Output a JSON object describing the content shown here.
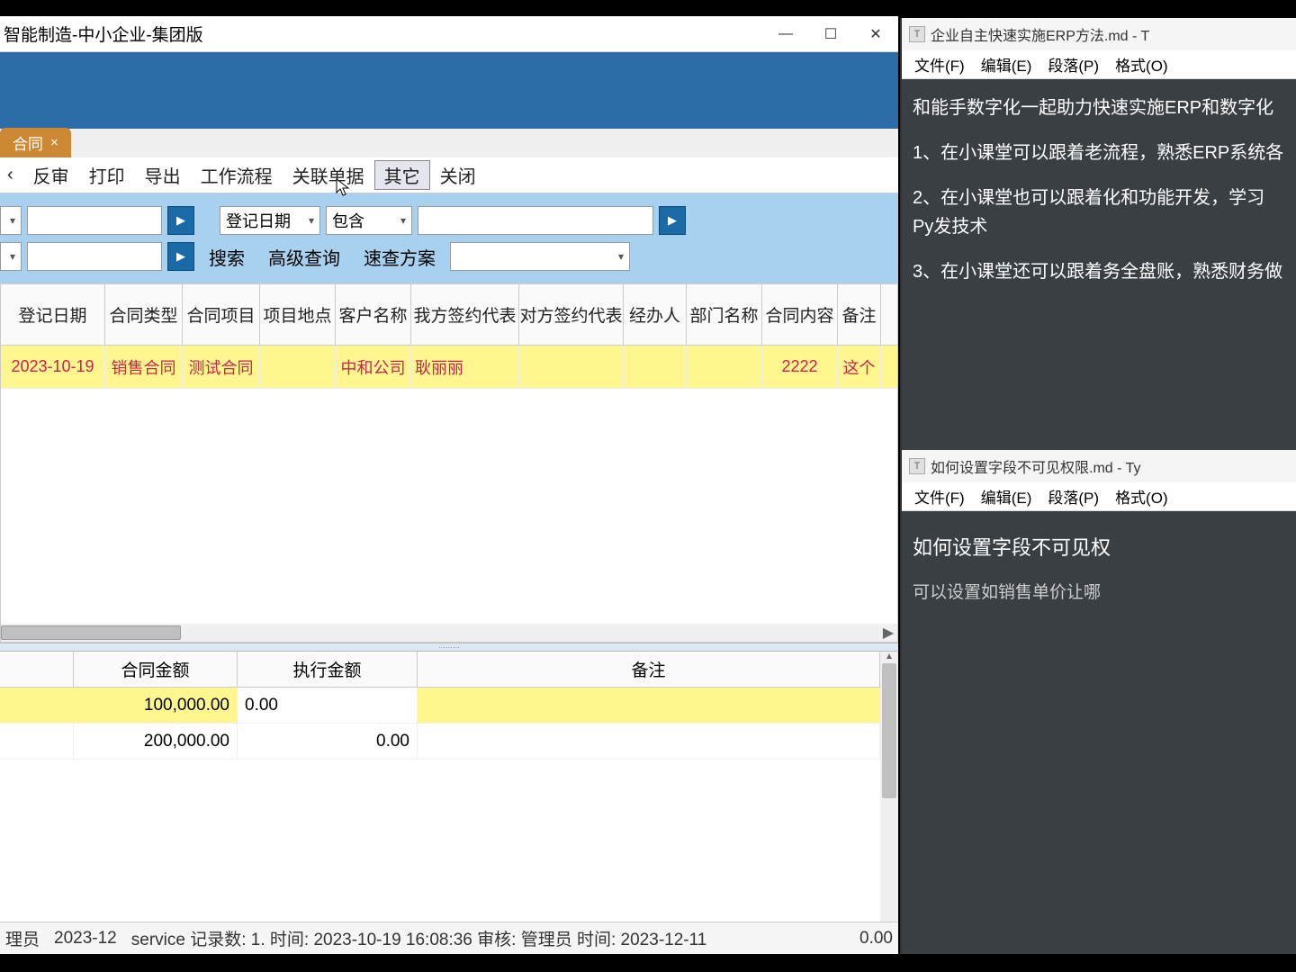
{
  "mainWindow": {
    "title": "智能制造-中小企业-集团版",
    "tab": {
      "label": "合同",
      "close": "×"
    },
    "toolbar": [
      "反审",
      "打印",
      "导出",
      "工作流程",
      "关联单据",
      "其它",
      "关闭"
    ],
    "filter": {
      "field1": "登记日期",
      "op": "包含",
      "search": "搜索",
      "advSearch": "高级查询",
      "quickPlan": "速查方案"
    },
    "grid": {
      "cols": [
        "登记日期",
        "合同类型",
        "合同项目",
        "项目地点",
        "客户名称",
        "我方签约代表",
        "对方签约代表",
        "经办人",
        "部门名称",
        "合同内容",
        "备注"
      ],
      "row": {
        "date": "2023-10-19",
        "type": "销售合同",
        "project": "测试合同",
        "location": "",
        "customer": "中和公司",
        "ourRep": "耿丽丽",
        "theirRep": "",
        "handler": "",
        "dept": "",
        "content": "2222",
        "remark": "这个"
      }
    },
    "detail": {
      "cols": [
        "合同金额",
        "执行金额",
        "备注"
      ],
      "rows": [
        {
          "amount": "100,000.00",
          "exec": "0.00",
          "remark": ""
        },
        {
          "amount": "200,000.00",
          "exec": "0.00",
          "remark": ""
        }
      ]
    },
    "statusbar": {
      "user": "理员",
      "period": "2023-12",
      "rest": "service 记录数: 1. 时间: 2023-10-19 16:08:36 审核: 管理员 时间: 2023-12-11",
      "num": "0.00"
    }
  },
  "sideWin1": {
    "title": "企业自主快速实施ERP方法.md - T",
    "menu": [
      "文件(F)",
      "编辑(E)",
      "段落(P)",
      "格式(O)"
    ],
    "content": {
      "p1": "和能手数字化一起助力快速实施ERP和数字化",
      "p2": "1、在小课堂可以跟着老流程，熟悉ERP系统各",
      "p3": "2、在小课堂也可以跟着化和功能开发，学习Py发技术",
      "p4": "3、在小课堂还可以跟着务全盘账，熟悉财务做"
    }
  },
  "sideWin2": {
    "title": "如何设置字段不可见权限.md - Ty",
    "menu": [
      "文件(F)",
      "编辑(E)",
      "段落(P)",
      "格式(O)"
    ],
    "content": {
      "h": "如何设置字段不可见权",
      "p": "可以设置如销售单价让哪"
    }
  }
}
